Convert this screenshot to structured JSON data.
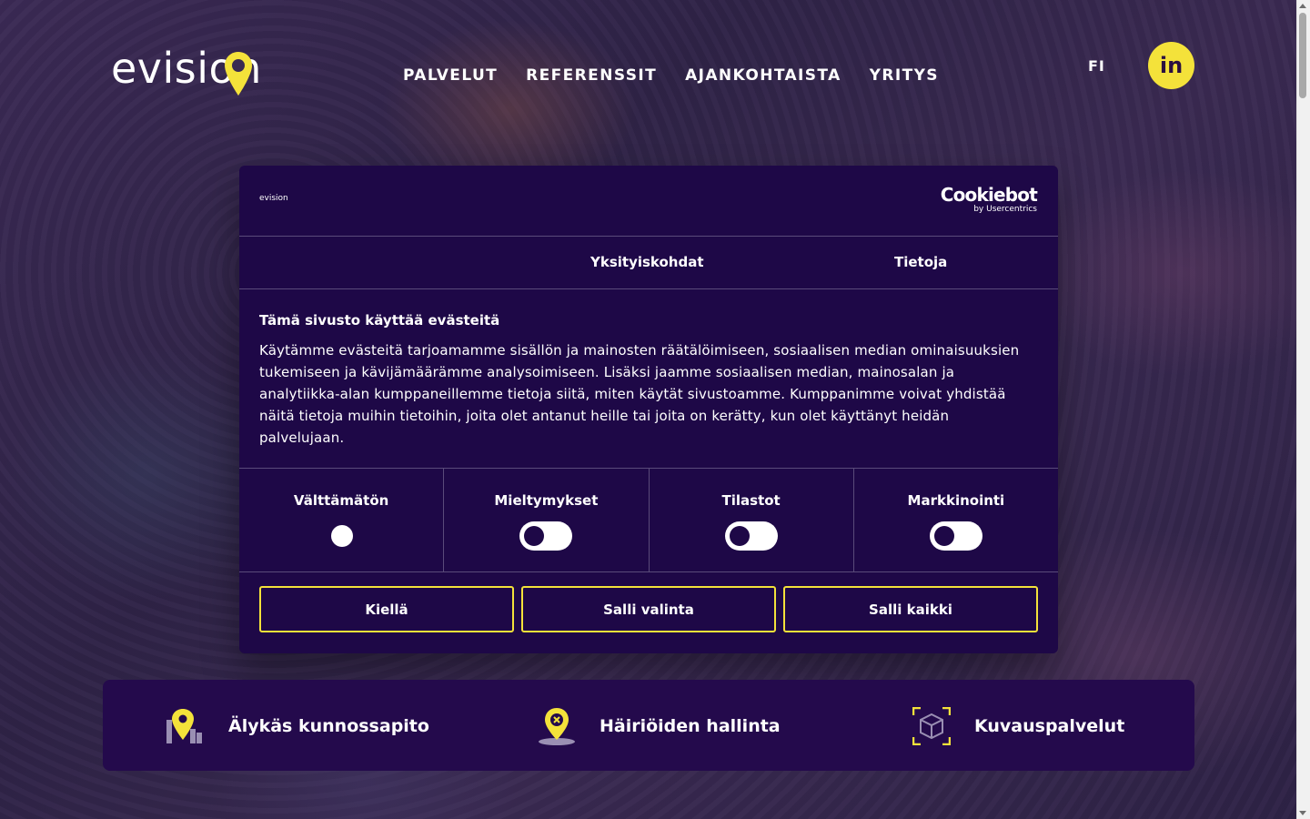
{
  "header": {
    "logo_text": "evision",
    "nav": [
      "PALVELUT",
      "REFERENSSIT",
      "AJANKOHTAISTA",
      "YRITYS"
    ],
    "lang": "FI",
    "linkedin_label": "in"
  },
  "dialog": {
    "logo_text": "evision",
    "cookiebot_main": "Cookiebot",
    "cookiebot_sub": "by Usercentrics",
    "tabs": [
      "Yksityiskohdat",
      "Tietoja"
    ],
    "title": "Tämä sivusto käyttää evästeitä",
    "text": "Käytämme evästeitä tarjoamamme sisällön ja mainosten räätälöimiseen, sosiaalisen median ominaisuuksien tukemiseen ja kävijämäärämme analysoimiseen. Lisäksi jaamme sosiaalisen median, mainosalan ja analytiikka-alan kumppaneillemme tietoja siitä, miten käytät sivustoamme. Kumppanimme voivat yhdistää näitä tietoja muihin tietoihin, joita olet antanut heille tai joita on kerätty, kun olet käyttänyt heidän palvelujaan.",
    "toggles": [
      {
        "label": "Välttämätön",
        "state": "on-disabled"
      },
      {
        "label": "Mieltymykset",
        "state": "off"
      },
      {
        "label": "Tilastot",
        "state": "off"
      },
      {
        "label": "Markkinointi",
        "state": "off"
      }
    ],
    "buttons": [
      "Kiellä",
      "Salli valinta",
      "Salli kaikki"
    ]
  },
  "services": [
    {
      "label": "Älykäs kunnossapito",
      "icon": "map-pin-chart-icon"
    },
    {
      "label": "Häiriöiden hallinta",
      "icon": "map-pin-x-icon"
    },
    {
      "label": "Kuvauspalvelut",
      "icon": "cube-scan-icon"
    }
  ],
  "colors": {
    "accent": "#f4e23a",
    "dialog_bg": "#1e0847",
    "services_bg": "#240a4c"
  }
}
